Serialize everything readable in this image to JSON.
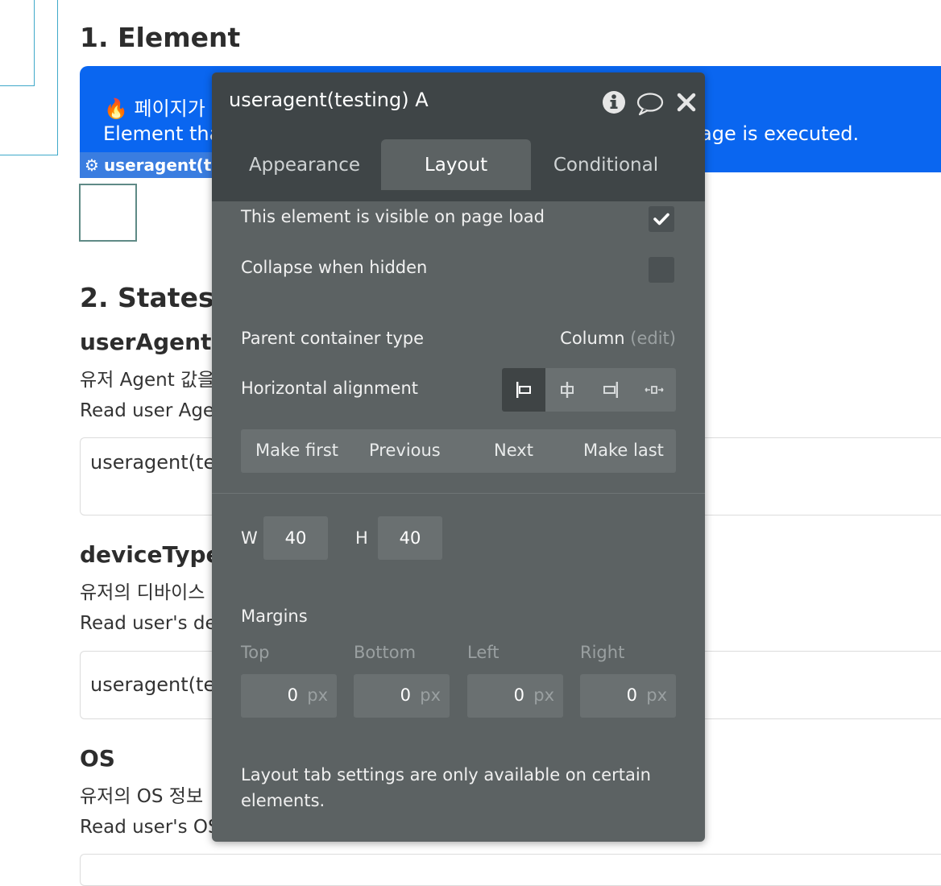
{
  "page": {
    "section_element_title": "1. Element",
    "banner_line1": "🔥 페이지가 실",
    "banner_line2_left": "Element tha",
    "banner_line2_right": "age is executed.",
    "element_tag": "useragent(te",
    "section_states_title": "2. States",
    "states": [
      {
        "title": "userAgent",
        "desc_ko": "유저 Agent 값을",
        "desc_en": "Read user Age",
        "output": "useragent(tes"
      },
      {
        "title": "deviceType",
        "desc_ko": "유저의 디바이스",
        "desc_en": "Read user's de",
        "output": "useragent(tes"
      },
      {
        "title": "OS",
        "desc_ko": "유저의 OS  정보",
        "desc_en": "Read user's OS",
        "output": ""
      }
    ]
  },
  "panel": {
    "title": "useragent(testing) A",
    "tabs": [
      "Appearance",
      "Layout",
      "Conditional"
    ],
    "active_tab": "Layout",
    "visible_on_load_label": "This element is visible on page load",
    "visible_on_load_checked": true,
    "collapse_label": "Collapse when hidden",
    "collapse_checked": false,
    "parent_container_label": "Parent container type",
    "parent_container_value": "Column",
    "parent_container_edit": "(edit)",
    "horizontal_alignment_label": "Horizontal alignment",
    "horizontal_alignment_selected": "left",
    "order_buttons": [
      "Make first",
      "Previous",
      "Next",
      "Make last"
    ],
    "width_label": "W",
    "width_value": "40",
    "height_label": "H",
    "height_value": "40",
    "margins_label": "Margins",
    "margins": [
      {
        "label": "Top",
        "value": "0",
        "unit": "px"
      },
      {
        "label": "Bottom",
        "value": "0",
        "unit": "px"
      },
      {
        "label": "Left",
        "value": "0",
        "unit": "px"
      },
      {
        "label": "Right",
        "value": "0",
        "unit": "px"
      }
    ],
    "footer_note": "Layout tab settings are only available on certain elements."
  }
}
